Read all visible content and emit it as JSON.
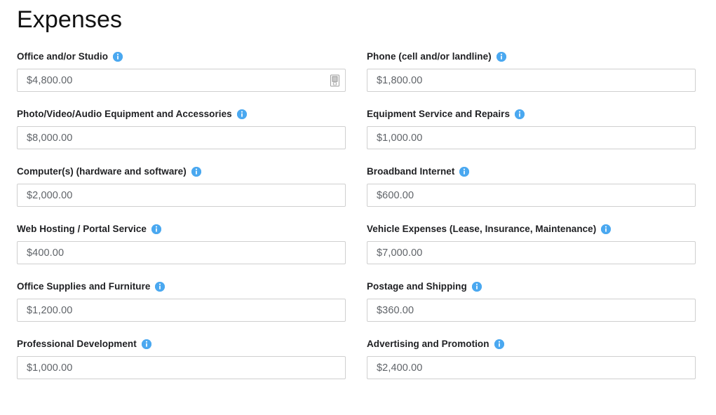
{
  "page": {
    "title": "Expenses"
  },
  "icons": {
    "info": "info-circle-icon",
    "addon": "autofill-document-icon"
  },
  "colors": {
    "info_icon_blue": "#4aa8f0",
    "input_border": "#cfcfcf",
    "input_text": "#5f6368",
    "label_text": "#202124",
    "page_background": "#ffffff"
  },
  "fields": [
    {
      "id": "office-and-or-studio",
      "label": "Office and/or Studio",
      "value": "$4,800.00",
      "placeholder": "$4,800.00",
      "column": "left",
      "has_addon": true
    },
    {
      "id": "phone-cell-and-or-landline",
      "label": "Phone (cell and/or landline)",
      "value": "$1,800.00",
      "placeholder": "$1,800.00",
      "column": "right",
      "has_addon": false
    },
    {
      "id": "photo-video-audio-equipment-and-accessories",
      "label": "Photo/Video/Audio Equipment and Accessories",
      "value": "$8,000.00",
      "placeholder": "$8,000.00",
      "column": "left",
      "has_addon": false
    },
    {
      "id": "equipment-service-and-repairs",
      "label": "Equipment Service and Repairs",
      "value": "$1,000.00",
      "placeholder": "$1,000.00",
      "column": "right",
      "has_addon": false
    },
    {
      "id": "computers-hardware-and-software",
      "label": "Computer(s) (hardware and software)",
      "value": "$2,000.00",
      "placeholder": "$2,000.00",
      "column": "left",
      "has_addon": false
    },
    {
      "id": "broadband-internet",
      "label": "Broadband Internet",
      "value": "$600.00",
      "placeholder": "$600.00",
      "column": "right",
      "has_addon": false
    },
    {
      "id": "web-hosting-portal-service",
      "label": "Web Hosting / Portal Service",
      "value": "$400.00",
      "placeholder": "$400.00",
      "column": "left",
      "has_addon": false
    },
    {
      "id": "vehicle-expenses",
      "label": "Vehicle Expenses (Lease, Insurance, Maintenance)",
      "value": "$7,000.00",
      "placeholder": "$7,000.00",
      "column": "right",
      "has_addon": false
    },
    {
      "id": "office-supplies-and-furniture",
      "label": "Office Supplies and Furniture",
      "value": "$1,200.00",
      "placeholder": "$1,200.00",
      "column": "left",
      "has_addon": false
    },
    {
      "id": "postage-and-shipping",
      "label": "Postage and Shipping",
      "value": "$360.00",
      "placeholder": "$360.00",
      "column": "right",
      "has_addon": false
    },
    {
      "id": "professional-development",
      "label": "Professional Development",
      "value": "$1,000.00",
      "placeholder": "$1,000.00",
      "column": "left",
      "has_addon": false
    },
    {
      "id": "advertising-and-promotion",
      "label": "Advertising and Promotion",
      "value": "$2,400.00",
      "placeholder": "$2,400.00",
      "column": "right",
      "has_addon": false
    }
  ]
}
